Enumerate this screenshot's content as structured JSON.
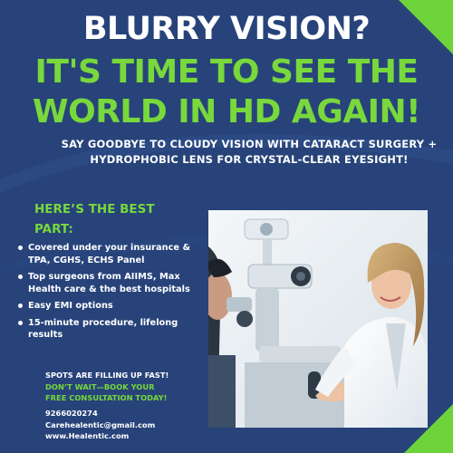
{
  "ad": {
    "headline_line1": "BLURRY VISION?",
    "headline_line2": "IT'S TIME TO SEE THE",
    "headline_line3": "WORLD IN HD AGAIN!",
    "subheadline": "SAY GOODBYE TO CLOUDY VISION WITH CATARACT SURGERY + HYDROPHOBIC LENS FOR CRYSTAL-CLEAR EYESIGHT!",
    "best_part_heading": "HERE’S THE BEST PART:",
    "benefits": [
      "Covered under your insurance & TPA, CGHS, ECHS Panel",
      " Top surgeons from AIIMS, Max Health care & the best hospitals",
      " Easy EMI options",
      "15-minute procedure, lifelong results"
    ],
    "cta_line1": "SPOTS ARE FILLING UP FAST!",
    "cta_line2": "DON’T WAIT—BOOK YOUR",
    "cta_line3": "FREE CONSULTATION TODAY!",
    "phone": "9266020274",
    "email": "Carehealentic@gmail.com",
    "website": "www.Healentic.com"
  },
  "colors": {
    "background": "#27437a",
    "accent_green": "#78d83c",
    "text_white": "#ffffff"
  },
  "photo": {
    "subject": "eye-exam-photo"
  }
}
